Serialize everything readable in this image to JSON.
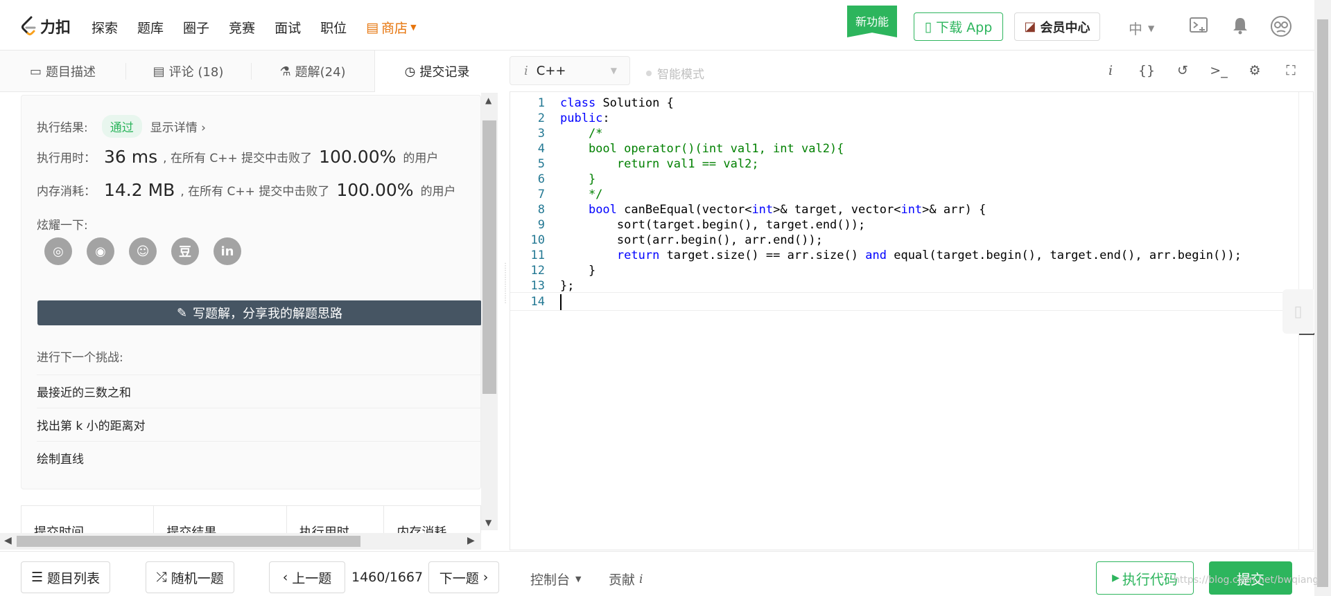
{
  "brand": {
    "logo_text": "力扣",
    "accent": "#2db55d",
    "shop_color": "#e6740b"
  },
  "nav": {
    "items": [
      "探索",
      "题库",
      "圈子",
      "竞赛",
      "面试",
      "职位"
    ],
    "shop": "商店",
    "new_feature": "新功能",
    "download_app": "下载 App",
    "vip_center": "会员中心",
    "lang": "中"
  },
  "left_tabs": [
    {
      "label": "题目描述",
      "icon": "document-icon"
    },
    {
      "label": "评论 (18)",
      "icon": "comment-icon"
    },
    {
      "label": "题解(24)",
      "icon": "flask-icon"
    },
    {
      "label": "提交记录",
      "icon": "clock-icon",
      "active": true
    }
  ],
  "result": {
    "exec_result_label": "执行结果:",
    "status": "通过",
    "details": "显示详情 ›",
    "time_label": "执行用时：",
    "time_value": "36 ms",
    "time_text": ", 在所有 C++ 提交中击败了",
    "time_pct": "100.00%",
    "time_suffix": "的用户",
    "mem_label": "内存消耗：",
    "mem_value": "14.2 MB",
    "mem_text": ", 在所有 C++ 提交中击败了",
    "mem_pct": "100.00%",
    "mem_suffix": "的用户",
    "share_label": "炫耀一下:",
    "share_icons": [
      "wechat-icon",
      "weibo-icon",
      "qq-icon",
      "douban-icon",
      "linkedin-icon"
    ],
    "share_glyphs": [
      "◎",
      "◉",
      "☺",
      "豆",
      "in"
    ],
    "write_solution": "写题解，分享我的解题思路",
    "next_title": "进行下一个挑战:",
    "next_items": [
      "最接近的三数之和",
      "找出第 k 小的距离对",
      "绘制直线"
    ]
  },
  "submissions_table": {
    "headers": [
      "提交时间",
      "提交结果",
      "执行用时",
      "内存消耗"
    ]
  },
  "editor": {
    "language": "C++",
    "smart_mode": "智能模式",
    "lines": [
      {
        "n": "1",
        "text": "class Solution {"
      },
      {
        "n": "2",
        "text": "public:"
      },
      {
        "n": "3",
        "text": "    /*"
      },
      {
        "n": "4",
        "text": "    bool operator()(int val1, int val2){"
      },
      {
        "n": "5",
        "text": "        return val1 == val2;"
      },
      {
        "n": "6",
        "text": "    }"
      },
      {
        "n": "7",
        "text": "    */"
      },
      {
        "n": "8",
        "text": "    bool canBeEqual(vector<int>& target, vector<int>& arr) {"
      },
      {
        "n": "9",
        "text": "        sort(target.begin(), target.end());"
      },
      {
        "n": "10",
        "text": "        sort(arr.begin(), arr.end());"
      },
      {
        "n": "11",
        "text": "        return target.size() == arr.size() and equal(target.begin(), target.end(), arr.begin());"
      },
      {
        "n": "12",
        "text": "    }"
      },
      {
        "n": "13",
        "text": "};"
      },
      {
        "n": "14",
        "text": ""
      }
    ]
  },
  "bottom": {
    "problem_list": "题目列表",
    "random": "随机一题",
    "prev": "上一题",
    "page": "1460/1667",
    "next": "下一题",
    "console": "控制台",
    "contribute": "贡献",
    "run_code": "执行代码",
    "submit": "提交"
  },
  "watermark": "https://blog.csdn.net/bwqiang"
}
